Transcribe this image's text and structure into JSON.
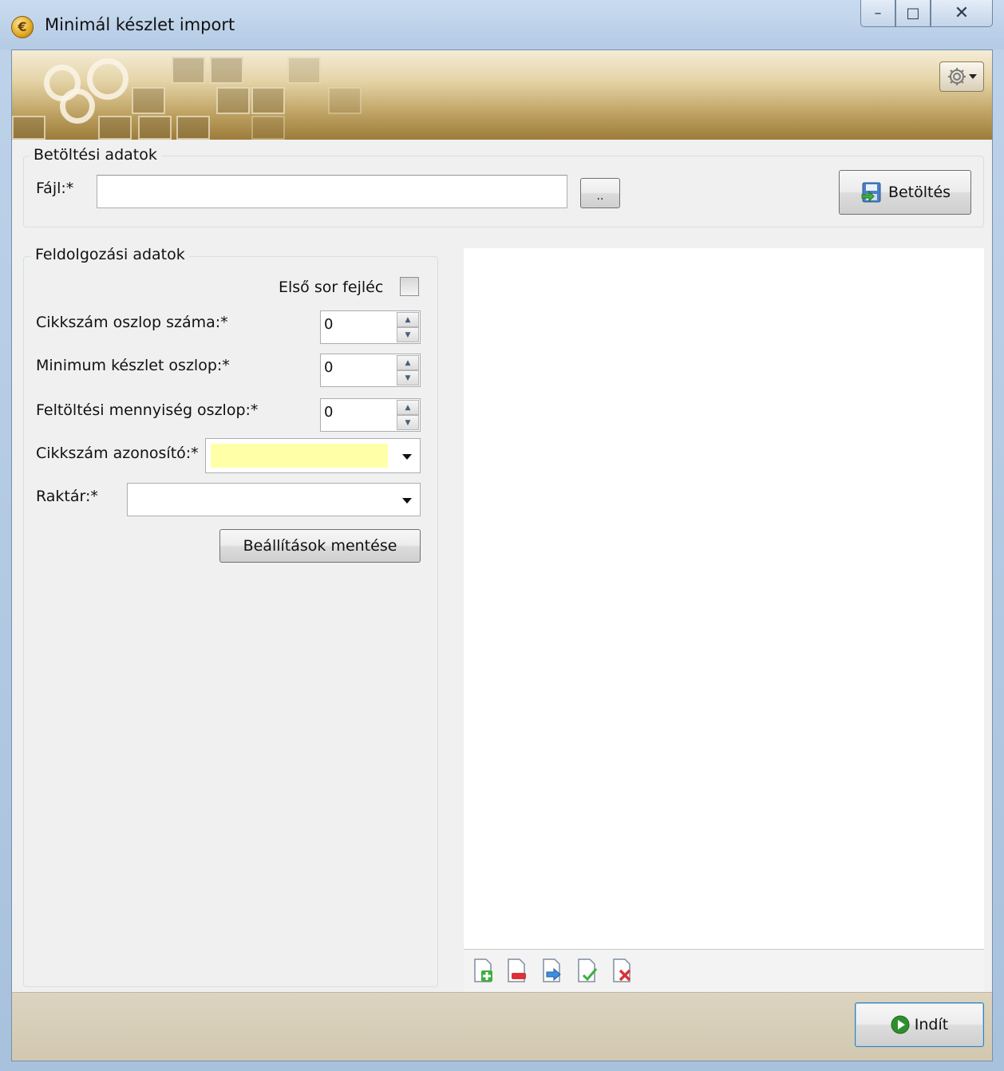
{
  "window": {
    "title": "Minimál készlet import",
    "app_icon_glyph": "€",
    "minimize_glyph": "–",
    "maximize_glyph": "□",
    "close_glyph": "✕"
  },
  "load_group": {
    "legend": "Betöltési adatok",
    "file_label": "Fájl:*",
    "file_value": "",
    "browse_label": "..",
    "load_button": "Betöltés"
  },
  "process_group": {
    "legend": "Feldolgozási adatok",
    "first_row_header_label": "Első sor fejléc",
    "first_row_header_checked": false,
    "item_column_label": "Cikkszám oszlop száma:*",
    "item_column_value": "0",
    "min_stock_column_label": "Minimum készlet oszlop:*",
    "min_stock_column_value": "0",
    "refill_qty_column_label": "Feltöltési mennyiség oszlop:*",
    "refill_qty_column_value": "0",
    "item_identifier_label": "Cikkszám azonosító:*",
    "item_identifier_value": "",
    "warehouse_label": "Raktár:*",
    "warehouse_value": "",
    "save_settings_button": "Beállítások mentése"
  },
  "grid_toolbar": {
    "icons": [
      "add-row-icon",
      "remove-row-icon",
      "move-row-icon",
      "edit-row-icon",
      "delete-row-icon"
    ]
  },
  "footer": {
    "start_button": "Indít"
  },
  "colors": {
    "required_field_highlight": "#ffffa8",
    "start_icon_green": "#2f8f2f"
  }
}
